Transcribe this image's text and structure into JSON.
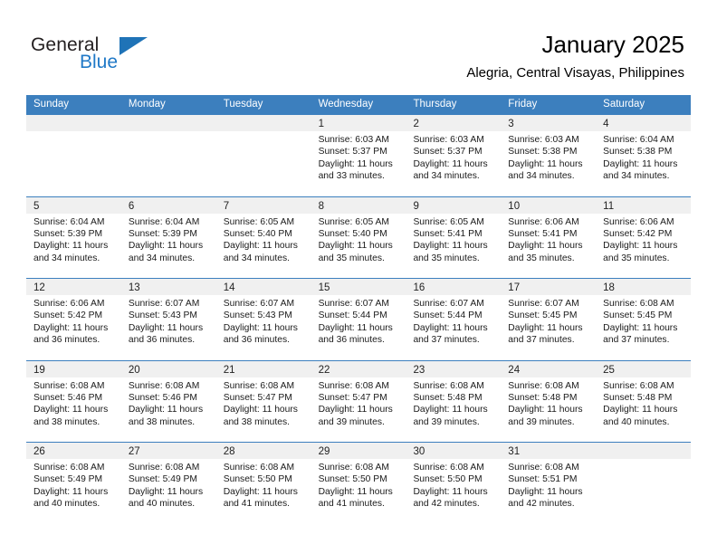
{
  "brand": {
    "word_one": "General",
    "word_two": "Blue",
    "triangle_icon": "triangle-icon",
    "accent_color": "#1f73b7",
    "text_color": "#231f20"
  },
  "header": {
    "title": "January 2025",
    "subtitle": "Alegria, Central Visayas, Philippines"
  },
  "theme": {
    "header_blue": "#3c7fbe",
    "day_band_gray": "#f0f0f0",
    "text_black": "#000000"
  },
  "weekdays": [
    "Sunday",
    "Monday",
    "Tuesday",
    "Wednesday",
    "Thursday",
    "Friday",
    "Saturday"
  ],
  "weeks": [
    [
      {
        "day": "",
        "sunrise": "",
        "sunset": "",
        "daylight_1": "",
        "daylight_2": ""
      },
      {
        "day": "",
        "sunrise": "",
        "sunset": "",
        "daylight_1": "",
        "daylight_2": ""
      },
      {
        "day": "",
        "sunrise": "",
        "sunset": "",
        "daylight_1": "",
        "daylight_2": ""
      },
      {
        "day": "1",
        "sunrise": "Sunrise: 6:03 AM",
        "sunset": "Sunset: 5:37 PM",
        "daylight_1": "Daylight: 11 hours",
        "daylight_2": "and 33 minutes."
      },
      {
        "day": "2",
        "sunrise": "Sunrise: 6:03 AM",
        "sunset": "Sunset: 5:37 PM",
        "daylight_1": "Daylight: 11 hours",
        "daylight_2": "and 34 minutes."
      },
      {
        "day": "3",
        "sunrise": "Sunrise: 6:03 AM",
        "sunset": "Sunset: 5:38 PM",
        "daylight_1": "Daylight: 11 hours",
        "daylight_2": "and 34 minutes."
      },
      {
        "day": "4",
        "sunrise": "Sunrise: 6:04 AM",
        "sunset": "Sunset: 5:38 PM",
        "daylight_1": "Daylight: 11 hours",
        "daylight_2": "and 34 minutes."
      }
    ],
    [
      {
        "day": "5",
        "sunrise": "Sunrise: 6:04 AM",
        "sunset": "Sunset: 5:39 PM",
        "daylight_1": "Daylight: 11 hours",
        "daylight_2": "and 34 minutes."
      },
      {
        "day": "6",
        "sunrise": "Sunrise: 6:04 AM",
        "sunset": "Sunset: 5:39 PM",
        "daylight_1": "Daylight: 11 hours",
        "daylight_2": "and 34 minutes."
      },
      {
        "day": "7",
        "sunrise": "Sunrise: 6:05 AM",
        "sunset": "Sunset: 5:40 PM",
        "daylight_1": "Daylight: 11 hours",
        "daylight_2": "and 34 minutes."
      },
      {
        "day": "8",
        "sunrise": "Sunrise: 6:05 AM",
        "sunset": "Sunset: 5:40 PM",
        "daylight_1": "Daylight: 11 hours",
        "daylight_2": "and 35 minutes."
      },
      {
        "day": "9",
        "sunrise": "Sunrise: 6:05 AM",
        "sunset": "Sunset: 5:41 PM",
        "daylight_1": "Daylight: 11 hours",
        "daylight_2": "and 35 minutes."
      },
      {
        "day": "10",
        "sunrise": "Sunrise: 6:06 AM",
        "sunset": "Sunset: 5:41 PM",
        "daylight_1": "Daylight: 11 hours",
        "daylight_2": "and 35 minutes."
      },
      {
        "day": "11",
        "sunrise": "Sunrise: 6:06 AM",
        "sunset": "Sunset: 5:42 PM",
        "daylight_1": "Daylight: 11 hours",
        "daylight_2": "and 35 minutes."
      }
    ],
    [
      {
        "day": "12",
        "sunrise": "Sunrise: 6:06 AM",
        "sunset": "Sunset: 5:42 PM",
        "daylight_1": "Daylight: 11 hours",
        "daylight_2": "and 36 minutes."
      },
      {
        "day": "13",
        "sunrise": "Sunrise: 6:07 AM",
        "sunset": "Sunset: 5:43 PM",
        "daylight_1": "Daylight: 11 hours",
        "daylight_2": "and 36 minutes."
      },
      {
        "day": "14",
        "sunrise": "Sunrise: 6:07 AM",
        "sunset": "Sunset: 5:43 PM",
        "daylight_1": "Daylight: 11 hours",
        "daylight_2": "and 36 minutes."
      },
      {
        "day": "15",
        "sunrise": "Sunrise: 6:07 AM",
        "sunset": "Sunset: 5:44 PM",
        "daylight_1": "Daylight: 11 hours",
        "daylight_2": "and 36 minutes."
      },
      {
        "day": "16",
        "sunrise": "Sunrise: 6:07 AM",
        "sunset": "Sunset: 5:44 PM",
        "daylight_1": "Daylight: 11 hours",
        "daylight_2": "and 37 minutes."
      },
      {
        "day": "17",
        "sunrise": "Sunrise: 6:07 AM",
        "sunset": "Sunset: 5:45 PM",
        "daylight_1": "Daylight: 11 hours",
        "daylight_2": "and 37 minutes."
      },
      {
        "day": "18",
        "sunrise": "Sunrise: 6:08 AM",
        "sunset": "Sunset: 5:45 PM",
        "daylight_1": "Daylight: 11 hours",
        "daylight_2": "and 37 minutes."
      }
    ],
    [
      {
        "day": "19",
        "sunrise": "Sunrise: 6:08 AM",
        "sunset": "Sunset: 5:46 PM",
        "daylight_1": "Daylight: 11 hours",
        "daylight_2": "and 38 minutes."
      },
      {
        "day": "20",
        "sunrise": "Sunrise: 6:08 AM",
        "sunset": "Sunset: 5:46 PM",
        "daylight_1": "Daylight: 11 hours",
        "daylight_2": "and 38 minutes."
      },
      {
        "day": "21",
        "sunrise": "Sunrise: 6:08 AM",
        "sunset": "Sunset: 5:47 PM",
        "daylight_1": "Daylight: 11 hours",
        "daylight_2": "and 38 minutes."
      },
      {
        "day": "22",
        "sunrise": "Sunrise: 6:08 AM",
        "sunset": "Sunset: 5:47 PM",
        "daylight_1": "Daylight: 11 hours",
        "daylight_2": "and 39 minutes."
      },
      {
        "day": "23",
        "sunrise": "Sunrise: 6:08 AM",
        "sunset": "Sunset: 5:48 PM",
        "daylight_1": "Daylight: 11 hours",
        "daylight_2": "and 39 minutes."
      },
      {
        "day": "24",
        "sunrise": "Sunrise: 6:08 AM",
        "sunset": "Sunset: 5:48 PM",
        "daylight_1": "Daylight: 11 hours",
        "daylight_2": "and 39 minutes."
      },
      {
        "day": "25",
        "sunrise": "Sunrise: 6:08 AM",
        "sunset": "Sunset: 5:48 PM",
        "daylight_1": "Daylight: 11 hours",
        "daylight_2": "and 40 minutes."
      }
    ],
    [
      {
        "day": "26",
        "sunrise": "Sunrise: 6:08 AM",
        "sunset": "Sunset: 5:49 PM",
        "daylight_1": "Daylight: 11 hours",
        "daylight_2": "and 40 minutes."
      },
      {
        "day": "27",
        "sunrise": "Sunrise: 6:08 AM",
        "sunset": "Sunset: 5:49 PM",
        "daylight_1": "Daylight: 11 hours",
        "daylight_2": "and 40 minutes."
      },
      {
        "day": "28",
        "sunrise": "Sunrise: 6:08 AM",
        "sunset": "Sunset: 5:50 PM",
        "daylight_1": "Daylight: 11 hours",
        "daylight_2": "and 41 minutes."
      },
      {
        "day": "29",
        "sunrise": "Sunrise: 6:08 AM",
        "sunset": "Sunset: 5:50 PM",
        "daylight_1": "Daylight: 11 hours",
        "daylight_2": "and 41 minutes."
      },
      {
        "day": "30",
        "sunrise": "Sunrise: 6:08 AM",
        "sunset": "Sunset: 5:50 PM",
        "daylight_1": "Daylight: 11 hours",
        "daylight_2": "and 42 minutes."
      },
      {
        "day": "31",
        "sunrise": "Sunrise: 6:08 AM",
        "sunset": "Sunset: 5:51 PM",
        "daylight_1": "Daylight: 11 hours",
        "daylight_2": "and 42 minutes."
      },
      {
        "day": "",
        "sunrise": "",
        "sunset": "",
        "daylight_1": "",
        "daylight_2": ""
      }
    ]
  ]
}
